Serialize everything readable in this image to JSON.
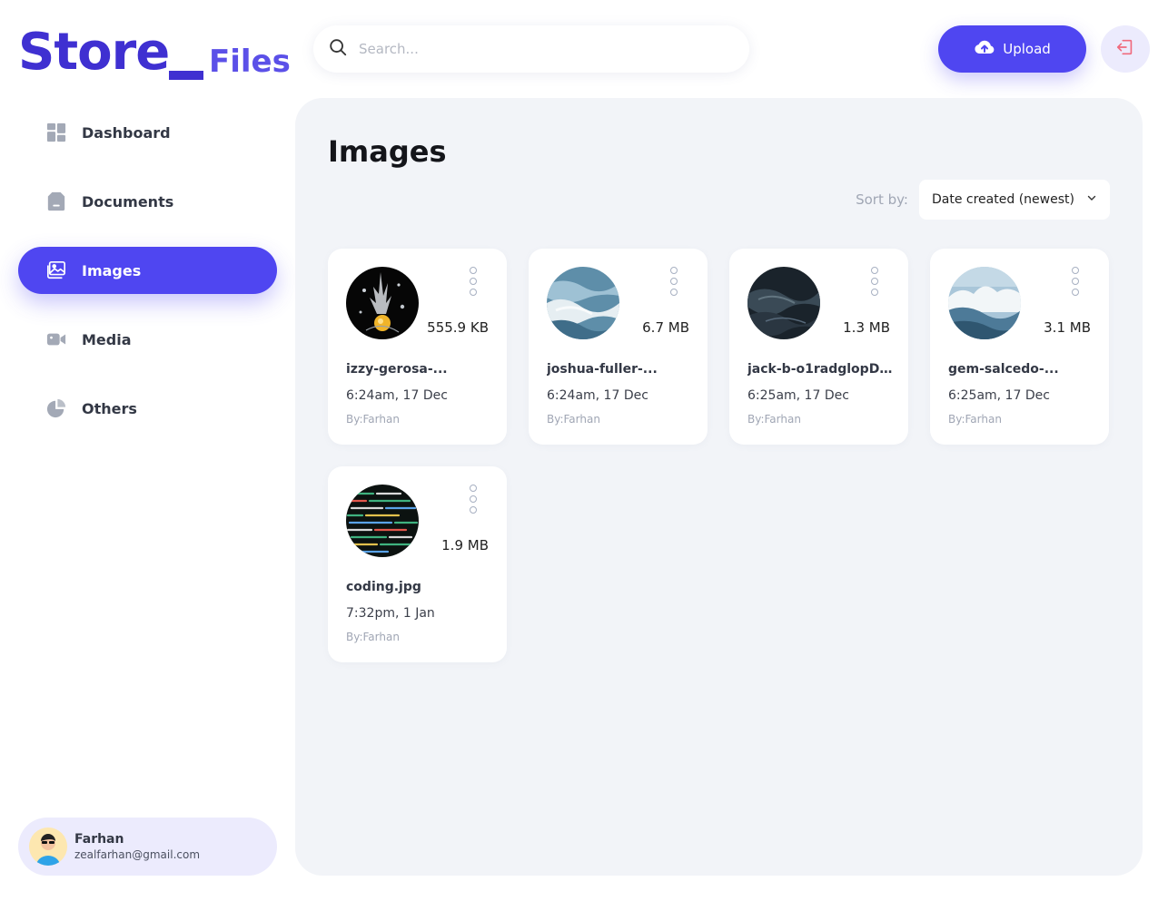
{
  "logo": {
    "store": "Store",
    "files": "Files"
  },
  "search": {
    "placeholder": "Search..."
  },
  "header": {
    "upload_label": "Upload"
  },
  "nav": {
    "items": [
      {
        "label": "Dashboard"
      },
      {
        "label": "Documents"
      },
      {
        "label": "Images",
        "active": true
      },
      {
        "label": "Media"
      },
      {
        "label": "Others"
      }
    ]
  },
  "user": {
    "name": "Farhan",
    "email": "zealfarhan@gmail.com"
  },
  "main": {
    "title": "Images",
    "sort_label": "Sort by:",
    "sort_value": "Date created (newest)"
  },
  "files": [
    {
      "name": "izzy-gerosa-...",
      "size": "555.9 KB",
      "date": "6:24am, 17 Dec",
      "by": "By:Farhan"
    },
    {
      "name": "joshua-fuller-...",
      "size": "6.7 MB",
      "date": "6:24am, 17 Dec",
      "by": "By:Farhan"
    },
    {
      "name": "jack-b-o1radglopDA...",
      "size": "1.3 MB",
      "date": "6:25am, 17 Dec",
      "by": "By:Farhan"
    },
    {
      "name": "gem-salcedo-...",
      "size": "3.1 MB",
      "date": "6:25am, 17 Dec",
      "by": "By:Farhan"
    },
    {
      "name": "coding.jpg",
      "size": "1.9 MB",
      "date": "7:32pm, 1 Jan",
      "by": "By:Farhan"
    }
  ],
  "colors": {
    "accent": "#4f46f1",
    "logo": "#3f30d1",
    "panel": "#f2f4f8"
  }
}
